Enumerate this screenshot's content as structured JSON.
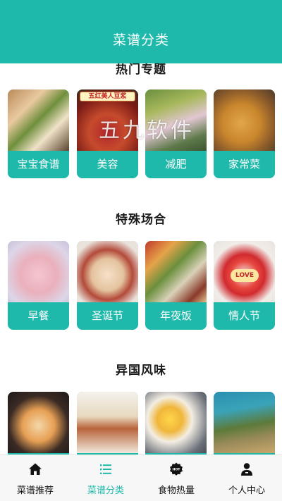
{
  "header": {
    "title": "菜谱分类"
  },
  "watermark": "五九软件",
  "sections": [
    {
      "title": "热门专题",
      "items": [
        {
          "label": "宝宝食谱"
        },
        {
          "label": "美容",
          "photo_text": "五红美人豆浆"
        },
        {
          "label": "减肥"
        },
        {
          "label": "家常菜"
        }
      ]
    },
    {
      "title": "特殊场合",
      "items": [
        {
          "label": "早餐"
        },
        {
          "label": "圣诞节"
        },
        {
          "label": "年夜饭"
        },
        {
          "label": "情人节",
          "photo_text": "LOVE"
        }
      ]
    },
    {
      "title": "异国风味",
      "items": [
        {
          "label": ""
        },
        {
          "label": ""
        },
        {
          "label": ""
        },
        {
          "label": ""
        }
      ]
    }
  ],
  "tabbar": {
    "items": [
      {
        "label": "菜谱推荐",
        "icon": "home-icon"
      },
      {
        "label": "菜谱分类",
        "icon": "list-icon"
      },
      {
        "label": "食物热量",
        "icon": "hot-badge-icon"
      },
      {
        "label": "个人中心",
        "icon": "person-icon"
      }
    ],
    "active_color": "#1fb9ac"
  },
  "colors": {
    "accent": "#1fb9ac",
    "text": "#111111"
  }
}
